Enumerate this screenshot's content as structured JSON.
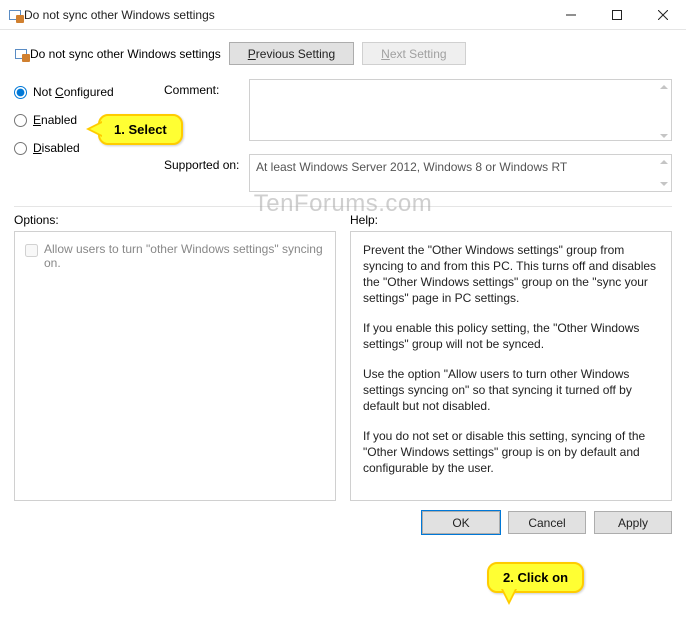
{
  "window": {
    "title": "Do not sync other Windows settings"
  },
  "header": {
    "label": "Do not sync other Windows settings",
    "previous": "Previous Setting",
    "next": "Next Setting"
  },
  "radios": {
    "not_configured": "Not Configured",
    "enabled": "Enabled",
    "disabled": "Disabled"
  },
  "labels": {
    "comment": "Comment:",
    "supported": "Supported on:",
    "options": "Options:",
    "help": "Help:"
  },
  "supported_text": "At least Windows Server 2012, Windows 8 or Windows RT",
  "option_checkbox": "Allow users to turn \"other Windows settings\" syncing on.",
  "help": {
    "p1": "Prevent the \"Other Windows settings\" group from syncing to and from this PC.  This turns off and disables the \"Other Windows settings\" group on the \"sync your settings\" page in PC settings.",
    "p2": "If you enable this policy setting, the \"Other Windows settings\" group will not be synced.",
    "p3": "Use the option \"Allow users to turn other Windows settings syncing on\" so that syncing it turned off by default but not disabled.",
    "p4": "If you do not set or disable this setting, syncing of the \"Other Windows settings\" group is on by default and configurable by the user."
  },
  "buttons": {
    "ok": "OK",
    "cancel": "Cancel",
    "apply": "Apply"
  },
  "callouts": {
    "c1": "1. Select",
    "c2": "2. Click on"
  },
  "watermark": "TenForums.com"
}
